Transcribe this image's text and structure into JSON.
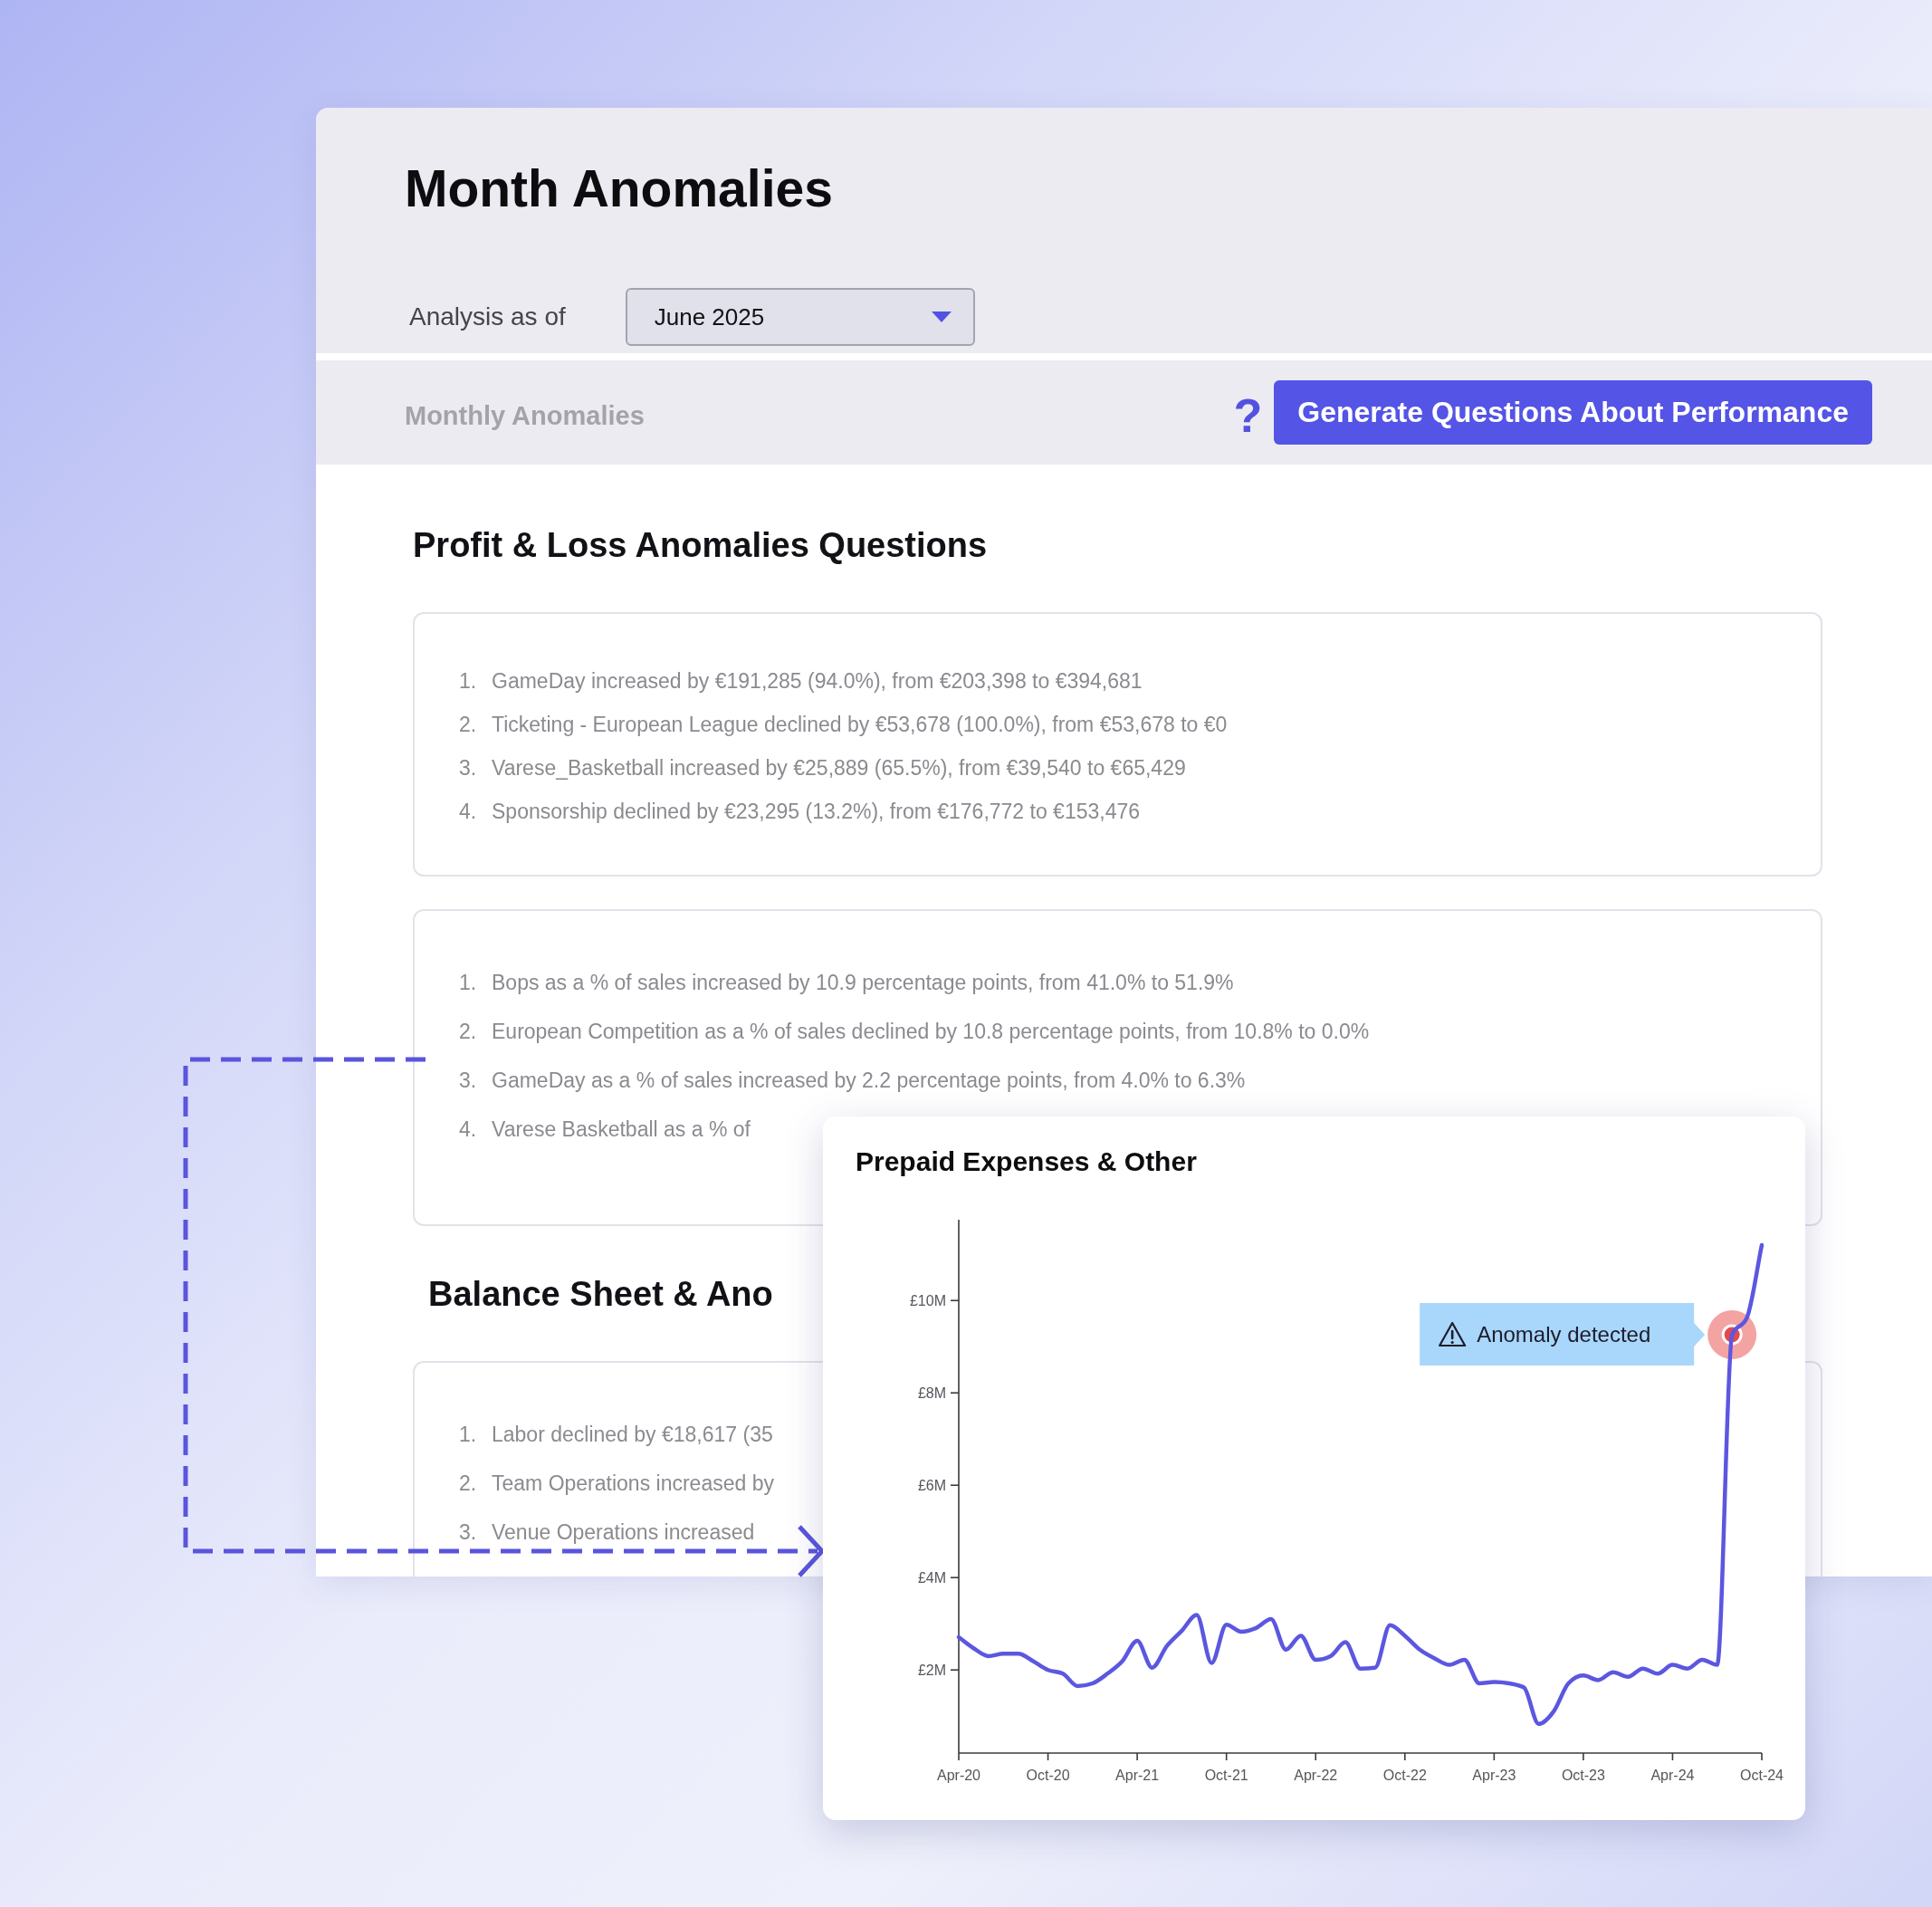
{
  "page": {
    "title": "Month Anomalies"
  },
  "analysis": {
    "label": "Analysis as of",
    "value": "June 2025"
  },
  "section_bar": {
    "label": "Monthly Anomalies",
    "help": "?",
    "button": "Generate Questions About Performance"
  },
  "sections": [
    {
      "heading": "Profit & Loss Anomalies Questions",
      "panels": [
        {
          "items": [
            {
              "number": "1.",
              "text": "GameDay increased by €191,285 (94.0%), from €203,398 to €394,681"
            },
            {
              "number": "2.",
              "text": "Ticketing - European League declined by €53,678 (100.0%), from €53,678 to €0"
            },
            {
              "number": "3.",
              "text": "Varese_Basketball increased by €25,889 (65.5%), from €39,540 to €65,429"
            },
            {
              "number": "4.",
              "text": "Sponsorship declined by €23,295 (13.2%), from €176,772 to €153,476"
            }
          ]
        },
        {
          "items": [
            {
              "number": "1.",
              "text": "Bops as a % of sales increased by 10.9 percentage points, from 41.0% to 51.9%"
            },
            {
              "number": "2.",
              "text": "European Competition as a % of sales declined by 10.8 percentage points, from 10.8% to 0.0%"
            },
            {
              "number": "3.",
              "text": "GameDay as a % of sales increased by 2.2 percentage points, from 4.0% to 6.3%"
            },
            {
              "number": "4.",
              "text": "Varese Basketball as a % of"
            }
          ]
        }
      ]
    },
    {
      "heading": "Balance Sheet & Ano",
      "panels": [
        {
          "items": [
            {
              "number": "1.",
              "text": "Labor declined by €18,617 (35"
            },
            {
              "number": "2.",
              "text": "Team Operations increased by"
            },
            {
              "number": "3.",
              "text": "Venue Operations increased"
            }
          ]
        }
      ]
    }
  ],
  "chart_card": {
    "chart_data": {
      "type": "line",
      "title": "Prepaid Expenses & Other",
      "categories": [
        "Apr-20",
        null,
        null,
        null,
        null,
        null,
        "Oct-20",
        null,
        null,
        null,
        null,
        null,
        "Apr-21",
        null,
        null,
        null,
        null,
        null,
        "Oct-21",
        null,
        null,
        null,
        null,
        null,
        "Apr-22",
        null,
        null,
        null,
        null,
        null,
        "Oct-22",
        null,
        null,
        null,
        null,
        null,
        "Apr-23",
        null,
        null,
        null,
        null,
        null,
        "Oct-23",
        null,
        null,
        null,
        null,
        null,
        "Apr-24",
        null,
        null,
        null,
        null,
        null,
        "Oct-24"
      ],
      "ylim": [
        0.2,
        11.75
      ],
      "yticks": [
        {
          "value": 2,
          "label": "£2M"
        },
        {
          "value": 4,
          "label": "£4M"
        },
        {
          "value": 6,
          "label": "£6M"
        },
        {
          "value": 8,
          "label": "£8M"
        },
        {
          "value": 10,
          "label": "£10M"
        }
      ],
      "series": [
        {
          "color": "#5b57e0",
          "values": [
            2.71,
            2.47,
            2.3,
            2.35,
            2.35,
            2.19,
            2.0,
            1.92,
            1.65,
            1.71,
            1.92,
            2.19,
            2.63,
            2.05,
            2.52,
            2.85,
            3.19,
            2.15,
            2.98,
            2.83,
            2.91,
            3.1,
            2.44,
            2.74,
            2.22,
            2.3,
            2.6,
            2.03,
            2.05,
            2.97,
            2.74,
            2.44,
            2.25,
            2.11,
            2.22,
            1.71,
            1.74,
            1.71,
            1.62,
            0.83,
            1.1,
            1.71,
            1.88,
            1.78,
            1.95,
            1.85,
            2.03,
            1.92,
            2.11,
            2.03,
            2.22,
            2.11,
            9.26,
            9.63,
            11.2
          ]
        }
      ],
      "annotations": [
        "Anomaly detected"
      ]
    }
  }
}
